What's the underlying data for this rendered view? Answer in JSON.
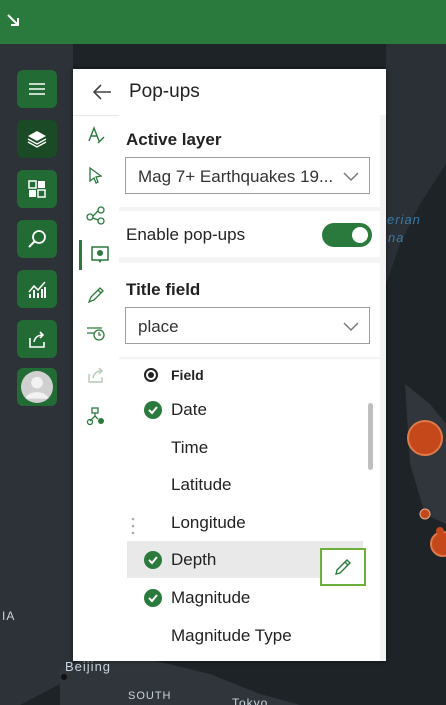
{
  "map_labels": {
    "beijing": "Beijing",
    "south": "SOUTH",
    "ia": "IA",
    "erian": "erian",
    "na": "na",
    "tokyo": "Tokyo"
  },
  "panel": {
    "title": "Pop-ups",
    "active_layer_label": "Active layer",
    "active_layer_value": "Mag 7+ Earthquakes 19...",
    "enable_popups_label": "Enable pop-ups",
    "enable_popups_on": true,
    "title_field_label": "Title field",
    "title_field_value": "place",
    "field_header": "Field",
    "fields": [
      {
        "label": "Date",
        "checked": true
      },
      {
        "label": "Time",
        "checked": false
      },
      {
        "label": "Latitude",
        "checked": false
      },
      {
        "label": "Longitude",
        "checked": false
      },
      {
        "label": "Depth",
        "checked": true
      },
      {
        "label": "Magnitude",
        "checked": true
      },
      {
        "label": "Magnitude Type",
        "checked": false
      }
    ]
  },
  "icons": [
    "expand-icon",
    "menu-icon",
    "layers-icon",
    "basemap-icon",
    "search-icon",
    "analysis-icon",
    "share-icon",
    "user-avatar"
  ],
  "colors": {
    "accent": "#2b7a3d",
    "highlight_border": "#6bb03a",
    "quake": "#c4481a"
  }
}
